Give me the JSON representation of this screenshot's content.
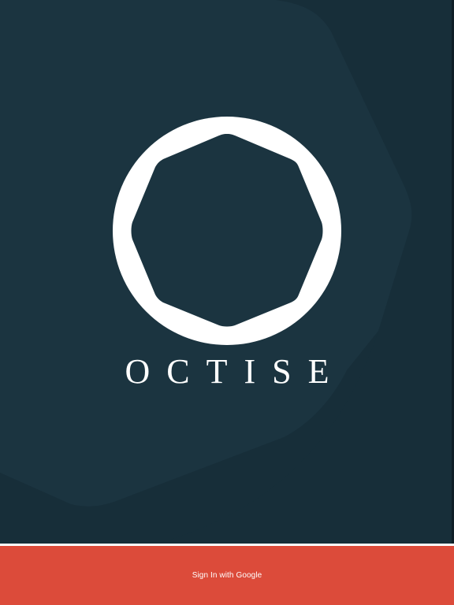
{
  "brand": {
    "name": "OCTISE",
    "logo_icon": "octagon-ring-icon"
  },
  "signin": {
    "label": "Sign In with Google"
  },
  "colors": {
    "background": "#1b3440",
    "background_shadow": "#152b35",
    "logo": "#ffffff",
    "signin_bar": "#dc4b3a",
    "signin_text": "#ffffff"
  }
}
